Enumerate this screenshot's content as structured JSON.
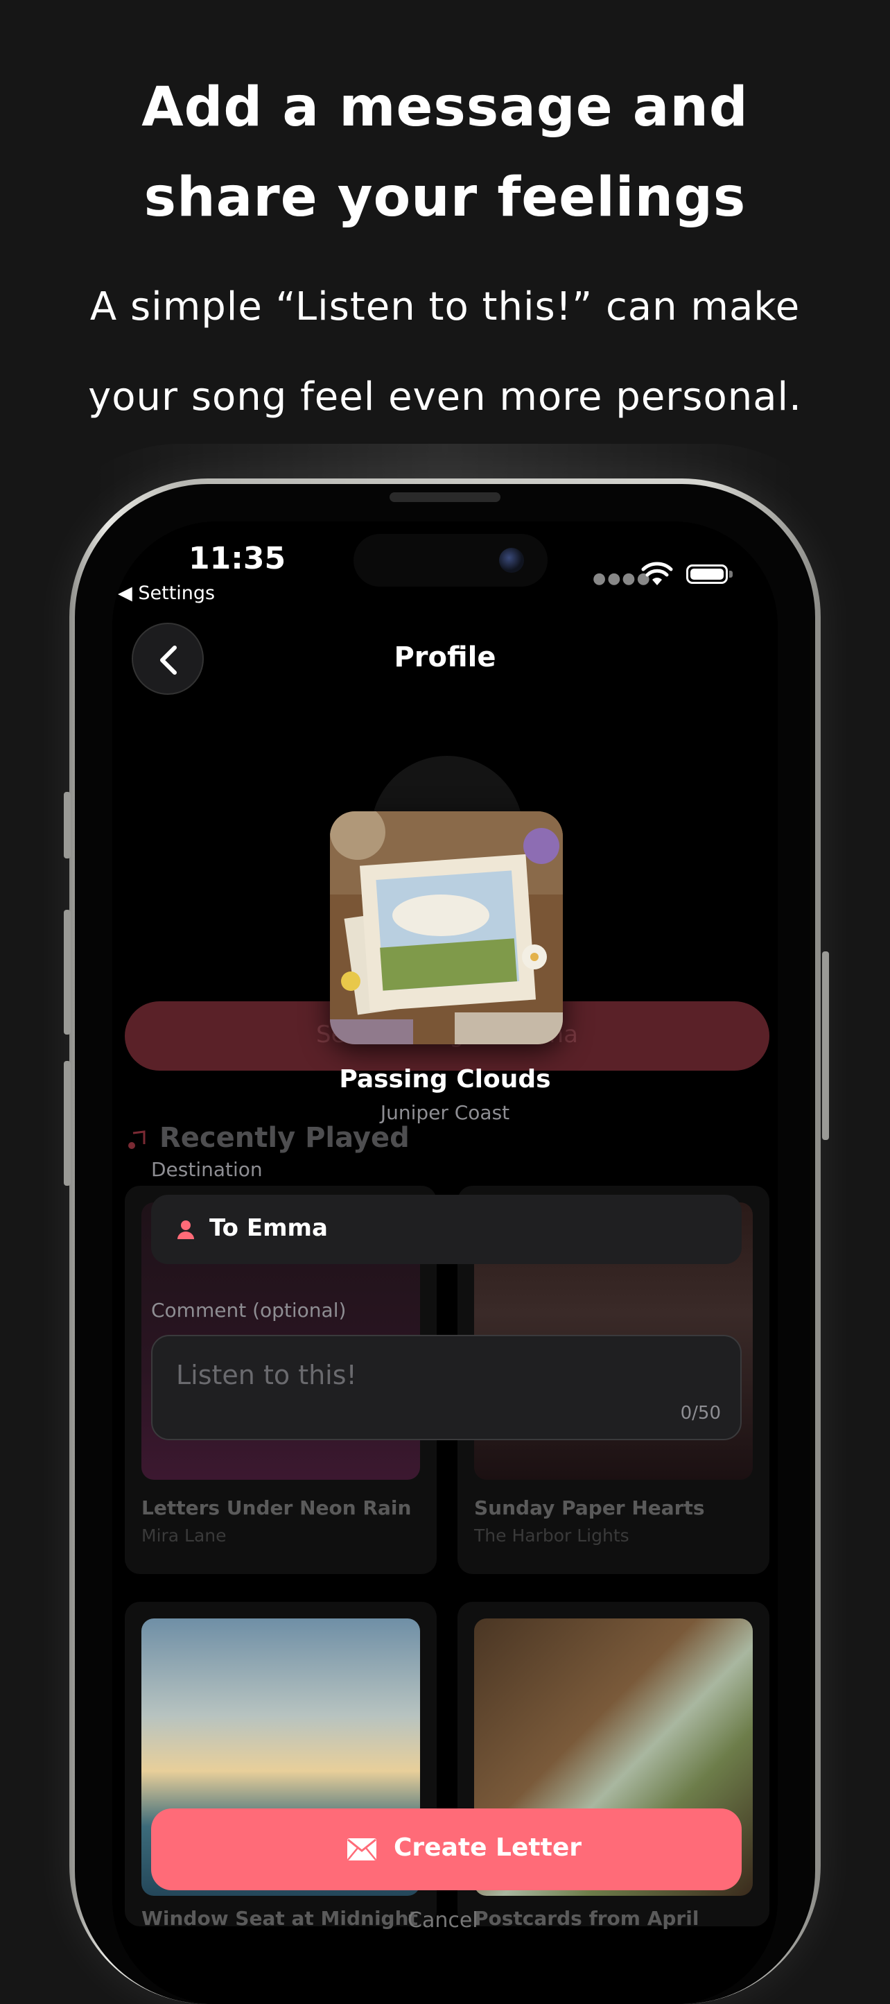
{
  "headline": [
    "Add a message and",
    "share your feelings"
  ],
  "subheadline": [
    "A simple “Listen to this!” can make",
    "your song feel even more personal."
  ],
  "status_bar": {
    "time": "11:35",
    "back_label": "Settings",
    "icons": [
      "wifi-icon",
      "battery-icon"
    ]
  },
  "nav": {
    "title": "Profile"
  },
  "background": {
    "send_button_label": "Send a Song to Emma",
    "section_title": "Recently Played",
    "cards": [
      {
        "title": "Letters Under Neon Rain",
        "artist": "Mira Lane"
      },
      {
        "title": "Sunday Paper Hearts",
        "artist": "The Harbor Lights"
      },
      {
        "title": "Window Seat at Midnight",
        "artist": ""
      },
      {
        "title": "Postcards from April",
        "artist": ""
      }
    ]
  },
  "song": {
    "title": "Passing Clouds",
    "artist": "Juniper Coast"
  },
  "destination": {
    "label": "Destination",
    "value": "To Emma"
  },
  "comment": {
    "label": "Comment (optional)",
    "placeholder": "Listen to this!",
    "value": "",
    "counter": "0/50"
  },
  "create_button": {
    "label": "Create Letter"
  },
  "cancel_label": "Cancel",
  "colors": {
    "accent": "#ff6b78",
    "background": "#161616",
    "field": "#1f1f21"
  }
}
